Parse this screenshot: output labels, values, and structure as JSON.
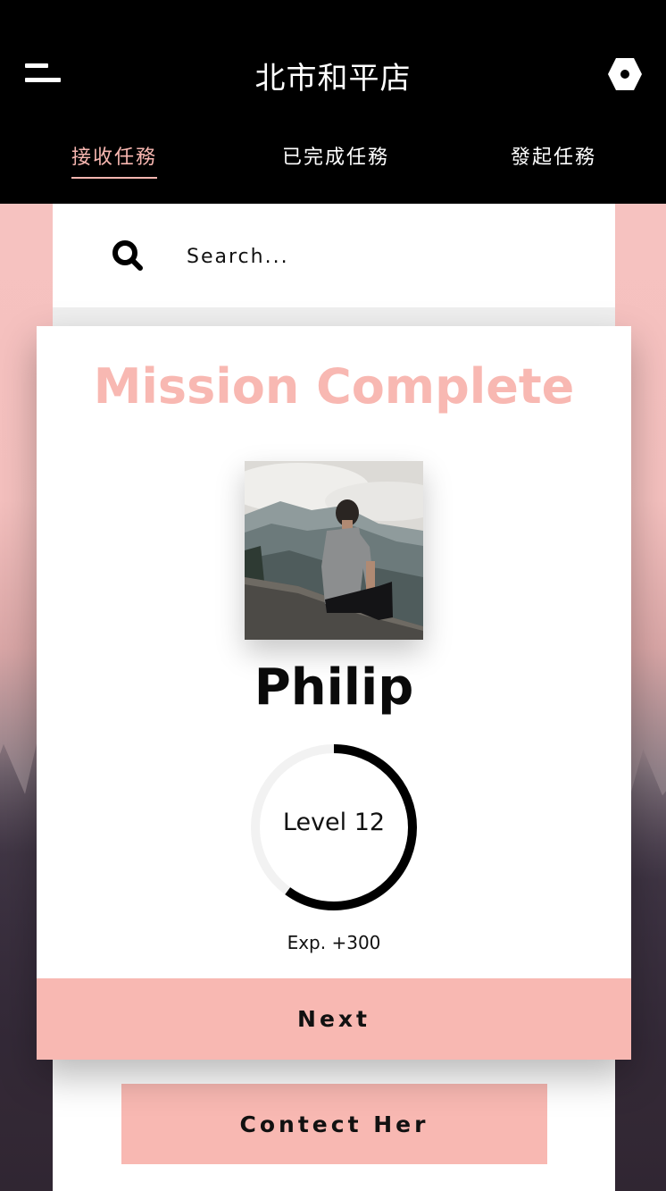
{
  "header": {
    "title": "北市和平店",
    "menu_icon": "menu-icon",
    "settings_icon": "settings-hex-icon"
  },
  "tabs": [
    {
      "label": "接收任務",
      "active": true
    },
    {
      "label": "已完成任務",
      "active": false
    },
    {
      "label": "發起任務",
      "active": false
    }
  ],
  "search": {
    "placeholder": "Search...",
    "icon": "search-icon"
  },
  "modal": {
    "title": "Mission Complete",
    "user_name": "Philip",
    "avatar_alt": "Philip",
    "level_label": "Level 12",
    "level_progress": 0.6,
    "exp_label": "Exp. +300",
    "next_label": "Next"
  },
  "panel": {
    "contact_label": "Contect Her"
  },
  "colors": {
    "accent": "#f8b8b2",
    "header_bg": "#000000",
    "ring": "#000000",
    "ring_track": "#f2f2f2"
  }
}
